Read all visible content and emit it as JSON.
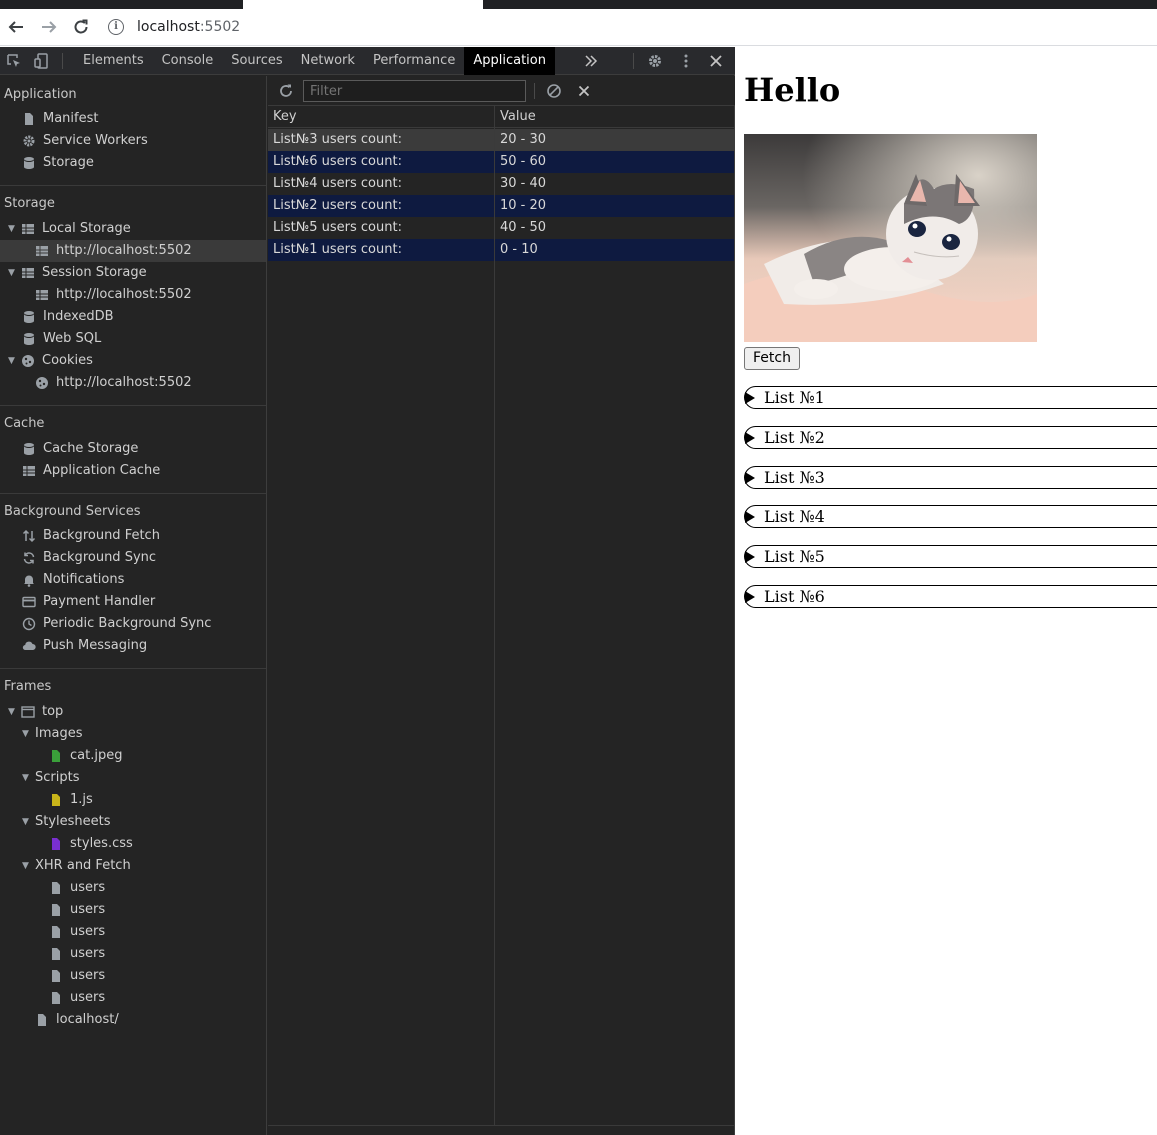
{
  "browser": {
    "url_host": "localhost",
    "url_port": ":5502"
  },
  "devtools": {
    "tabs": [
      "Elements",
      "Console",
      "Sources",
      "Network",
      "Performance",
      "Application"
    ],
    "active_tab": "Application",
    "sidebar": {
      "application_title": "Application",
      "application_items": [
        "Manifest",
        "Service Workers",
        "Storage"
      ],
      "storage_title": "Storage",
      "local_storage": "Local Storage",
      "local_storage_origin": "http://localhost:5502",
      "session_storage": "Session Storage",
      "session_storage_origin": "http://localhost:5502",
      "indexeddb": "IndexedDB",
      "websql": "Web SQL",
      "cookies": "Cookies",
      "cookies_origin": "http://localhost:5502",
      "cache_title": "Cache",
      "cache_storage": "Cache Storage",
      "application_cache": "Application Cache",
      "background_title": "Background Services",
      "background_items": [
        "Background Fetch",
        "Background Sync",
        "Notifications",
        "Payment Handler",
        "Periodic Background Sync",
        "Push Messaging"
      ],
      "frames_title": "Frames",
      "frame_top": "top",
      "images_folder": "Images",
      "image_file": "cat.jpeg",
      "scripts_folder": "Scripts",
      "script_file": "1.js",
      "stylesheets_folder": "Stylesheets",
      "stylesheet_file": "styles.css",
      "xhr_folder": "XHR and Fetch",
      "xhr_files": [
        "users",
        "users",
        "users",
        "users",
        "users",
        "users"
      ],
      "document": "localhost/"
    },
    "table": {
      "filter_placeholder": "Filter",
      "headers": {
        "key": "Key",
        "value": "Value"
      },
      "rows": [
        {
          "key": "List№3 users count:",
          "value": "20 - 30"
        },
        {
          "key": "List№6 users count:",
          "value": "50 - 60"
        },
        {
          "key": "List№4 users count:",
          "value": "30 - 40"
        },
        {
          "key": "List№2 users count:",
          "value": "10 - 20"
        },
        {
          "key": "List№5 users count:",
          "value": "40 - 50"
        },
        {
          "key": "List№1 users count:",
          "value": "0 - 10"
        }
      ]
    }
  },
  "page": {
    "heading": "Hello",
    "fetch_button": "Fetch",
    "lists": [
      "List №1",
      "List №2",
      "List №3",
      "List №4",
      "List №5",
      "List №6"
    ]
  },
  "colors": {
    "devtools_bg": "#242424",
    "selected_row": "#3b3b3b",
    "alt_row": "#0e1a40",
    "active_tab": "#000000"
  }
}
